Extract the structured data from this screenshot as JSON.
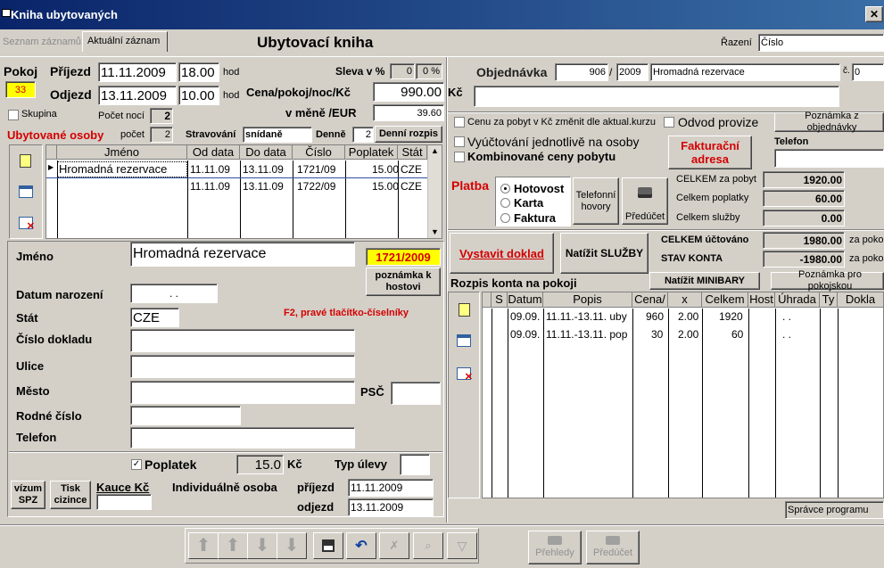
{
  "window": {
    "title": "Kniha ubytovaných"
  },
  "tabs": [
    {
      "label": "Seznam záznamů"
    },
    {
      "label": "Aktuální záznam"
    }
  ],
  "page_title": "Ubytovací kniha",
  "sort": {
    "label": "Řazení",
    "value": "Číslo"
  },
  "stay": {
    "pokoj_label": "Pokoj",
    "pokoj_value": "33",
    "prijezd_label": "Příjezd",
    "prijezd_date": "11.11.2009",
    "prijezd_time": "18.00",
    "odjezd_label": "Odjezd",
    "odjezd_date": "13.11.2009",
    "odjezd_time": "10.00",
    "hod": "hod",
    "skupina_label": "Skupina",
    "pocet_noci_label": "Počet nocí",
    "pocet_noci": "2"
  },
  "price": {
    "sleva_label": "Sleva v %",
    "sleva_value": "0",
    "sleva_pct": "0 %",
    "cena_label": "Cena/pokoj/noc/Kč",
    "cena_value": "990.00",
    "currency": "Kč",
    "mene_label": "v měně /EUR",
    "mene_value": "39.60"
  },
  "guests": {
    "title": "Ubytované osoby",
    "pocet_label": "počet",
    "pocet": "2",
    "stravovani_label": "Stravování",
    "stravovani_value": "snídaně",
    "denne_label": "Denně",
    "denne_value": "2",
    "denni_rozpis": "Denní rozpis",
    "columns": [
      "Jméno",
      "Od data",
      "Do data",
      "Číslo",
      "Poplatek",
      "Stát"
    ],
    "rows": [
      [
        "Hromadná rezervace",
        "11.11.09",
        "13.11.09",
        "1721/09",
        "15.00",
        "CZE"
      ],
      [
        "",
        "11.11.09",
        "13.11.09",
        "1722/09",
        "15.00",
        "CZE"
      ]
    ]
  },
  "detail": {
    "jmeno_label": "Jméno",
    "jmeno_value": "Hromadná rezervace",
    "cislo_badge": "1721/2009",
    "poznamka_btn": "poznámka k hostovi",
    "datum_label": "Datum narození",
    "datum_value": ". .",
    "stat_label": "Stát",
    "stat_value": "CZE",
    "hint": "F2, pravé tlačítko-číselníky",
    "doklad_label": "Číslo dokladu",
    "ulice_label": "Ulice",
    "mesto_label": "Město",
    "psc_label": "PSČ",
    "rodne_label": "Rodné číslo",
    "telefon_label": "Telefon",
    "poplatek_label": "Poplatek",
    "poplatek_value": "15.0",
    "poplatek_currency": "Kč",
    "typ_ulevy_label": "Typ úlevy",
    "vizum_btn": "vízum SPZ",
    "tisk_btn": "Tisk cizince",
    "kauce_label": "Kauce Kč",
    "indiv_label": "Individuálně osoba",
    "prijezd_label": "příjezd",
    "prijezd_value": "11.11.2009",
    "odjezd_label": "odjezd",
    "odjezd_value": "13.11.2009"
  },
  "order": {
    "label": "Objednávka",
    "number": "906",
    "year": "2009",
    "name": "Hromadná rezervace",
    "c_label": "č.",
    "c_value": "0",
    "cenu_label": "Cenu za pobyt v Kč změnit dle aktual.kurzu",
    "odvod_label": "Odvod provize",
    "poznamka_obj": "Poznámka z objednávky",
    "vyuct_label": "Vyúčtování jednotlivě na osoby",
    "komb_label": "Kombinované ceny pobytu",
    "fakt_btn": "Fakturační adresa",
    "telefon_label": "Telefon"
  },
  "totals": {
    "celkem_pobyt_label": "CELKEM za pobyt",
    "celkem_pobyt": "1920.00",
    "celkem_poplatky_label": "Celkem poplatky",
    "celkem_poplatky": "60.00",
    "celkem_sluzby_label": "Celkem služby",
    "celkem_sluzby": "0.00",
    "uctovano_label": "CELKEM účtováno",
    "uctovano": "1980.00",
    "stav_label": "STAV KONTA",
    "stav": "-1980.00",
    "za_poko": "za poko"
  },
  "payment": {
    "label": "Platba",
    "options": [
      "Hotovost",
      "Karta",
      "Faktura"
    ],
    "tel_btn": "Telefonní hovory",
    "preducet_btn": "Předúčet"
  },
  "actions": {
    "vystavit": "Vystavit doklad",
    "sluzby": "Natížit SLUŽBY",
    "minibary": "Natížit MINIBARY",
    "poznamka_pokoj": "Poznámka pro pokojskou"
  },
  "account": {
    "title": "Rozpis konta na pokoji",
    "columns": [
      "S",
      "Datum",
      "Popis",
      "Cena/",
      "x",
      "Celkem",
      "Host",
      "Úhrada",
      "Ty",
      "Dokla"
    ],
    "rows": [
      [
        "",
        "09.09.",
        "11.11.-13.11. uby",
        "960",
        "2.00",
        "1920",
        "",
        ". ."
      ],
      [
        "",
        "09.09.",
        "11.11.-13.11. pop",
        "30",
        "2.00",
        "60",
        "",
        ". ."
      ]
    ]
  },
  "status": {
    "user": "Správce programu"
  },
  "toolbar": {
    "prehledy": "Přehledy",
    "preducet": "Předúčet"
  },
  "colors": {
    "title_bar": "#0a246a",
    "accent_red": "#d40000",
    "yellow": "#ffff00"
  }
}
